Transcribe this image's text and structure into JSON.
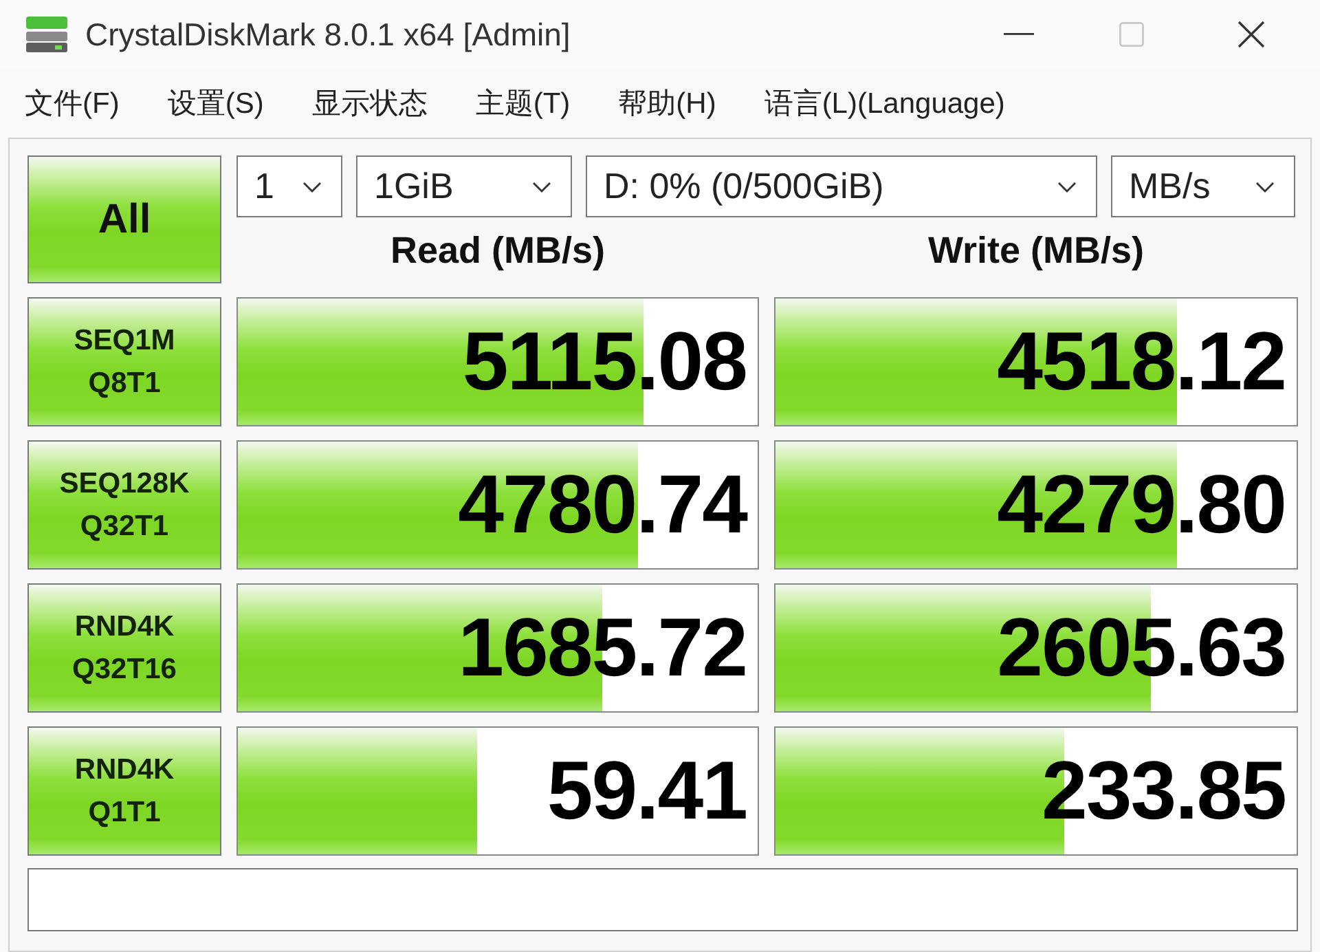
{
  "window": {
    "title": "CrystalDiskMark 8.0.1 x64 [Admin]",
    "maximize_disabled": true
  },
  "menu": [
    "文件(F)",
    "设置(S)",
    "显示状态",
    "主题(T)",
    "帮助(H)",
    "语言(L)(Language)"
  ],
  "all_button": "All",
  "selects": [
    {
      "value": "1"
    },
    {
      "value": "1GiB"
    },
    {
      "value": "D: 0% (0/500GiB)"
    },
    {
      "value": "MB/s"
    }
  ],
  "columns": [
    "Read (MB/s)",
    "Write (MB/s)"
  ],
  "rows": [
    {
      "test": "SEQ1M",
      "params": "Q8T1",
      "read": {
        "value": "5115.08",
        "level": 0.78
      },
      "write": {
        "value": "4518.12",
        "level": 0.77
      }
    },
    {
      "test": "SEQ128K",
      "params": "Q32T1",
      "read": {
        "value": "4780.74",
        "level": 0.77
      },
      "write": {
        "value": "4279.80",
        "level": 0.77
      }
    },
    {
      "test": "RND4K",
      "params": "Q32T16",
      "read": {
        "value": "1685.72",
        "level": 0.7
      },
      "write": {
        "value": "2605.63",
        "level": 0.72
      }
    },
    {
      "test": "RND4K",
      "params": "Q1T1",
      "read": {
        "value": "59.41",
        "level": 0.46
      },
      "write": {
        "value": "233.85",
        "level": 0.555
      }
    }
  ]
}
